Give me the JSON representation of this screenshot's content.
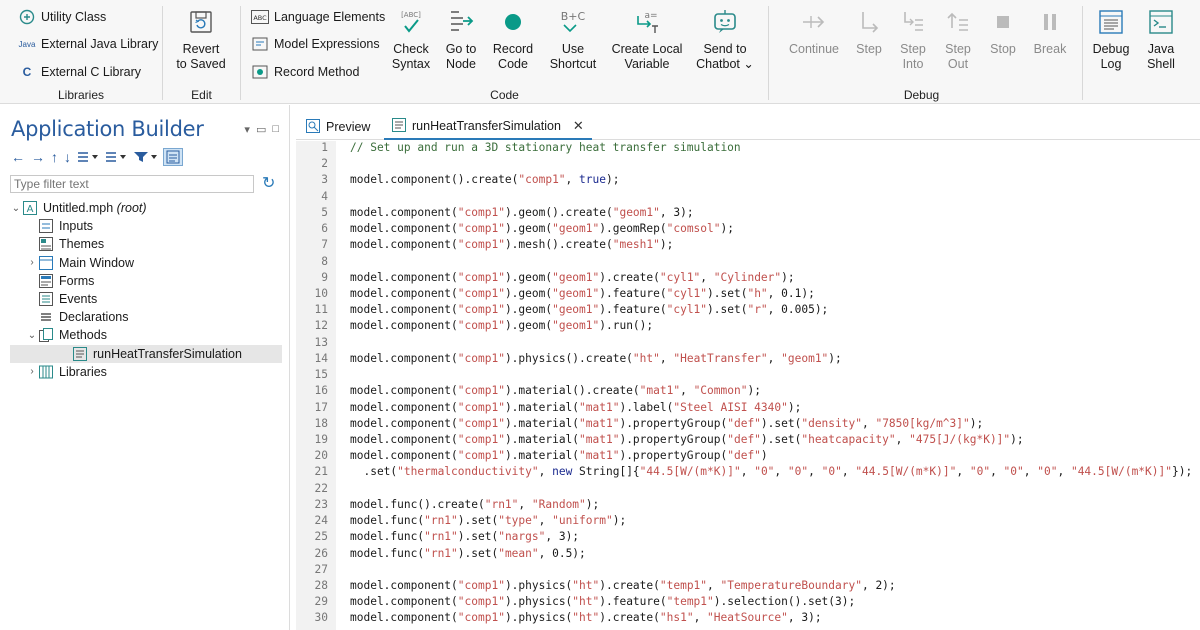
{
  "ribbon": {
    "libraries": {
      "label": "Libraries",
      "items": [
        "Utility Class",
        "External Java Library",
        "External C Library"
      ],
      "java_badge": "Java"
    },
    "edit": {
      "label": "Edit",
      "revert": "Revert\nto Saved"
    },
    "code": {
      "label": "Code",
      "small": [
        "Language Elements",
        "Model Expressions",
        "Record Method"
      ],
      "abc_badge": "[ABC]",
      "big": [
        "Check\nSyntax",
        "Go to\nNode",
        "Record\nCode",
        "Use\nShortcut",
        "Create Local\nVariable",
        "Send to\nChatbot ⌄"
      ],
      "shortcut_glyph": "B+C"
    },
    "debug": {
      "label": "Debug",
      "big": [
        "Continue",
        "Step",
        "Step\nInto",
        "Step\nOut",
        "Stop",
        "Break"
      ]
    },
    "extra": [
      "Debug\nLog",
      "Java\nShell"
    ]
  },
  "panel": {
    "title": "Application Builder",
    "filter_placeholder": "Type filter text",
    "tree": [
      {
        "label": "Untitled.mph",
        "suffix": "(root)"
      },
      {
        "label": "Inputs"
      },
      {
        "label": "Themes"
      },
      {
        "label": "Main Window"
      },
      {
        "label": "Forms"
      },
      {
        "label": "Events"
      },
      {
        "label": "Declarations"
      },
      {
        "label": "Methods"
      },
      {
        "label": "runHeatTransferSimulation"
      },
      {
        "label": "Libraries"
      }
    ]
  },
  "editor": {
    "tabs": [
      "Preview",
      "runHeatTransferSimulation"
    ],
    "lines": [
      [
        [
          "c",
          "// Set up and run a 3D stationary heat transfer simulation"
        ]
      ],
      [],
      [
        [
          "n",
          "model.component().create("
        ],
        [
          "s",
          "\"comp1\""
        ],
        [
          "n",
          ", "
        ],
        [
          "k",
          "true"
        ],
        [
          "n",
          ");"
        ]
      ],
      [],
      [
        [
          "n",
          "model.component("
        ],
        [
          "s",
          "\"comp1\""
        ],
        [
          "n",
          ").geom().create("
        ],
        [
          "s",
          "\"geom1\""
        ],
        [
          "n",
          ", 3);"
        ]
      ],
      [
        [
          "n",
          "model.component("
        ],
        [
          "s",
          "\"comp1\""
        ],
        [
          "n",
          ").geom("
        ],
        [
          "s",
          "\"geom1\""
        ],
        [
          "n",
          ").geomRep("
        ],
        [
          "s",
          "\"comsol\""
        ],
        [
          "n",
          ");"
        ]
      ],
      [
        [
          "n",
          "model.component("
        ],
        [
          "s",
          "\"comp1\""
        ],
        [
          "n",
          ").mesh().create("
        ],
        [
          "s",
          "\"mesh1\""
        ],
        [
          "n",
          ");"
        ]
      ],
      [],
      [
        [
          "n",
          "model.component("
        ],
        [
          "s",
          "\"comp1\""
        ],
        [
          "n",
          ").geom("
        ],
        [
          "s",
          "\"geom1\""
        ],
        [
          "n",
          ").create("
        ],
        [
          "s",
          "\"cyl1\""
        ],
        [
          "n",
          ", "
        ],
        [
          "s",
          "\"Cylinder\""
        ],
        [
          "n",
          ");"
        ]
      ],
      [
        [
          "n",
          "model.component("
        ],
        [
          "s",
          "\"comp1\""
        ],
        [
          "n",
          ").geom("
        ],
        [
          "s",
          "\"geom1\""
        ],
        [
          "n",
          ").feature("
        ],
        [
          "s",
          "\"cyl1\""
        ],
        [
          "n",
          ").set("
        ],
        [
          "s",
          "\"h\""
        ],
        [
          "n",
          ", 0.1);"
        ]
      ],
      [
        [
          "n",
          "model.component("
        ],
        [
          "s",
          "\"comp1\""
        ],
        [
          "n",
          ").geom("
        ],
        [
          "s",
          "\"geom1\""
        ],
        [
          "n",
          ").feature("
        ],
        [
          "s",
          "\"cyl1\""
        ],
        [
          "n",
          ").set("
        ],
        [
          "s",
          "\"r\""
        ],
        [
          "n",
          ", 0.005);"
        ]
      ],
      [
        [
          "n",
          "model.component("
        ],
        [
          "s",
          "\"comp1\""
        ],
        [
          "n",
          ").geom("
        ],
        [
          "s",
          "\"geom1\""
        ],
        [
          "n",
          ").run();"
        ]
      ],
      [],
      [
        [
          "n",
          "model.component("
        ],
        [
          "s",
          "\"comp1\""
        ],
        [
          "n",
          ").physics().create("
        ],
        [
          "s",
          "\"ht\""
        ],
        [
          "n",
          ", "
        ],
        [
          "s",
          "\"HeatTransfer\""
        ],
        [
          "n",
          ", "
        ],
        [
          "s",
          "\"geom1\""
        ],
        [
          "n",
          ");"
        ]
      ],
      [],
      [
        [
          "n",
          "model.component("
        ],
        [
          "s",
          "\"comp1\""
        ],
        [
          "n",
          ").material().create("
        ],
        [
          "s",
          "\"mat1\""
        ],
        [
          "n",
          ", "
        ],
        [
          "s",
          "\"Common\""
        ],
        [
          "n",
          ");"
        ]
      ],
      [
        [
          "n",
          "model.component("
        ],
        [
          "s",
          "\"comp1\""
        ],
        [
          "n",
          ").material("
        ],
        [
          "s",
          "\"mat1\""
        ],
        [
          "n",
          ").label("
        ],
        [
          "s",
          "\"Steel AISI 4340\""
        ],
        [
          "n",
          ");"
        ]
      ],
      [
        [
          "n",
          "model.component("
        ],
        [
          "s",
          "\"comp1\""
        ],
        [
          "n",
          ").material("
        ],
        [
          "s",
          "\"mat1\""
        ],
        [
          "n",
          ").propertyGroup("
        ],
        [
          "s",
          "\"def\""
        ],
        [
          "n",
          ").set("
        ],
        [
          "s",
          "\"density\""
        ],
        [
          "n",
          ", "
        ],
        [
          "s",
          "\"7850[kg/m^3]\""
        ],
        [
          "n",
          ");"
        ]
      ],
      [
        [
          "n",
          "model.component("
        ],
        [
          "s",
          "\"comp1\""
        ],
        [
          "n",
          ").material("
        ],
        [
          "s",
          "\"mat1\""
        ],
        [
          "n",
          ").propertyGroup("
        ],
        [
          "s",
          "\"def\""
        ],
        [
          "n",
          ").set("
        ],
        [
          "s",
          "\"heatcapacity\""
        ],
        [
          "n",
          ", "
        ],
        [
          "s",
          "\"475[J/(kg*K)]\""
        ],
        [
          "n",
          ");"
        ]
      ],
      [
        [
          "n",
          "model.component("
        ],
        [
          "s",
          "\"comp1\""
        ],
        [
          "n",
          ").material("
        ],
        [
          "s",
          "\"mat1\""
        ],
        [
          "n",
          ").propertyGroup("
        ],
        [
          "s",
          "\"def\""
        ],
        [
          "n",
          ")"
        ]
      ],
      [
        [
          "n",
          "  .set("
        ],
        [
          "s",
          "\"thermalconductivity\""
        ],
        [
          "n",
          ", "
        ],
        [
          "k",
          "new"
        ],
        [
          "n",
          " String[]{"
        ],
        [
          "s",
          "\"44.5[W/(m*K)]\""
        ],
        [
          "n",
          ", "
        ],
        [
          "s",
          "\"0\""
        ],
        [
          "n",
          ", "
        ],
        [
          "s",
          "\"0\""
        ],
        [
          "n",
          ", "
        ],
        [
          "s",
          "\"0\""
        ],
        [
          "n",
          ", "
        ],
        [
          "s",
          "\"44.5[W/(m*K)]\""
        ],
        [
          "n",
          ", "
        ],
        [
          "s",
          "\"0\""
        ],
        [
          "n",
          ", "
        ],
        [
          "s",
          "\"0\""
        ],
        [
          "n",
          ", "
        ],
        [
          "s",
          "\"0\""
        ],
        [
          "n",
          ", "
        ],
        [
          "s",
          "\"44.5[W/(m*K)]\""
        ],
        [
          "n",
          "});"
        ]
      ],
      [],
      [
        [
          "n",
          "model.func().create("
        ],
        [
          "s",
          "\"rn1\""
        ],
        [
          "n",
          ", "
        ],
        [
          "s",
          "\"Random\""
        ],
        [
          "n",
          ");"
        ]
      ],
      [
        [
          "n",
          "model.func("
        ],
        [
          "s",
          "\"rn1\""
        ],
        [
          "n",
          ").set("
        ],
        [
          "s",
          "\"type\""
        ],
        [
          "n",
          ", "
        ],
        [
          "s",
          "\"uniform\""
        ],
        [
          "n",
          ");"
        ]
      ],
      [
        [
          "n",
          "model.func("
        ],
        [
          "s",
          "\"rn1\""
        ],
        [
          "n",
          ").set("
        ],
        [
          "s",
          "\"nargs\""
        ],
        [
          "n",
          ", 3);"
        ]
      ],
      [
        [
          "n",
          "model.func("
        ],
        [
          "s",
          "\"rn1\""
        ],
        [
          "n",
          ").set("
        ],
        [
          "s",
          "\"mean\""
        ],
        [
          "n",
          ", 0.5);"
        ]
      ],
      [],
      [
        [
          "n",
          "model.component("
        ],
        [
          "s",
          "\"comp1\""
        ],
        [
          "n",
          ").physics("
        ],
        [
          "s",
          "\"ht\""
        ],
        [
          "n",
          ").create("
        ],
        [
          "s",
          "\"temp1\""
        ],
        [
          "n",
          ", "
        ],
        [
          "s",
          "\"TemperatureBoundary\""
        ],
        [
          "n",
          ", 2);"
        ]
      ],
      [
        [
          "n",
          "model.component("
        ],
        [
          "s",
          "\"comp1\""
        ],
        [
          "n",
          ").physics("
        ],
        [
          "s",
          "\"ht\""
        ],
        [
          "n",
          ").feature("
        ],
        [
          "s",
          "\"temp1\""
        ],
        [
          "n",
          ").selection().set(3);"
        ]
      ],
      [
        [
          "n",
          "model.component("
        ],
        [
          "s",
          "\"comp1\""
        ],
        [
          "n",
          ").physics("
        ],
        [
          "s",
          "\"ht\""
        ],
        [
          "n",
          ").create("
        ],
        [
          "s",
          "\"hs1\""
        ],
        [
          "n",
          ", "
        ],
        [
          "s",
          "\"HeatSource\""
        ],
        [
          "n",
          ", 3);"
        ]
      ]
    ]
  }
}
